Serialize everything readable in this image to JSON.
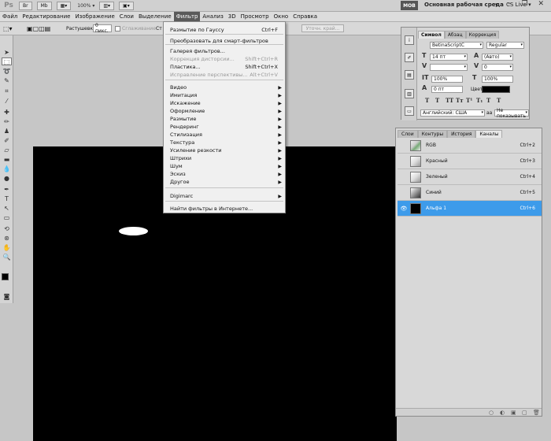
{
  "appbar": {
    "logo": "Ps",
    "zoom": "100%",
    "workspace_btn": "MOB",
    "workspace_title": "Основная рабочая среда",
    "workspace_arrow": "▾",
    "cslive": "CS Live ▾",
    "win_controls": "– ❐ ✕"
  },
  "menubar": [
    "Файл",
    "Редактирование",
    "Изображение",
    "Слои",
    "Выделение",
    "Фильтр",
    "Анализ",
    "3D",
    "Просмотр",
    "Окно",
    "Справка"
  ],
  "menubar_active": "Фильтр",
  "options": {
    "feather_label": "Растушевка:",
    "feather_value": "0 пикс.",
    "antialias": "Сглаживание",
    "style_label": "Ст",
    "refine_edge": "Уточн. край..."
  },
  "filter_menu": {
    "items": [
      {
        "label": "Размытие по Гауссу",
        "shortcut": "Ctrl+F"
      },
      {
        "label": "Преобразовать для смарт-фильтров"
      },
      {
        "label": "Галерея фильтров..."
      },
      {
        "label": "Коррекция дисторсии...",
        "shortcut": "Shift+Ctrl+R",
        "disabled": true
      },
      {
        "label": "Пластика...",
        "shortcut": "Shift+Ctrl+X"
      },
      {
        "label": "Исправление перспективы...",
        "shortcut": "Alt+Ctrl+V",
        "disabled": true
      },
      {
        "label": "Видео",
        "submenu": true
      },
      {
        "label": "Имитация",
        "submenu": true
      },
      {
        "label": "Искажение",
        "submenu": true
      },
      {
        "label": "Оформление",
        "submenu": true
      },
      {
        "label": "Размытие",
        "submenu": true
      },
      {
        "label": "Рендеринг",
        "submenu": true
      },
      {
        "label": "Стилизация",
        "submenu": true
      },
      {
        "label": "Текстура",
        "submenu": true
      },
      {
        "label": "Усиление резкости",
        "submenu": true
      },
      {
        "label": "Штрихи",
        "submenu": true
      },
      {
        "label": "Шум",
        "submenu": true
      },
      {
        "label": "Эскиз",
        "submenu": true
      },
      {
        "label": "Другое",
        "submenu": true
      },
      {
        "label": "Digimarc",
        "submenu": true
      },
      {
        "label": "Найти фильтры в Интернете..."
      }
    ]
  },
  "character_panel": {
    "tabs": [
      "Символ",
      "Абзац",
      "Коррекция"
    ],
    "font_family": "BetinaScriptC",
    "font_style": "Regular",
    "font_size": "14 пт",
    "leading": "(Авто)",
    "kerning": "",
    "tracking": "0",
    "vscale": "100%",
    "hscale": "100%",
    "baseline": "0 пт",
    "color_label": "Цвет:",
    "color_value": "#000000",
    "styles": [
      "T",
      "T",
      "TT",
      "Tт",
      "T¹",
      "T₁",
      "T",
      "T"
    ],
    "language": "Английский: США",
    "aa": "Не показывать"
  },
  "channels_panel": {
    "tabs": [
      "Слои",
      "Контуры",
      "История",
      "Каналы"
    ],
    "active_tab": "Каналы",
    "rows": [
      {
        "name": "RGB",
        "shortcut": "Ctrl+2"
      },
      {
        "name": "Красный",
        "shortcut": "Ctrl+3"
      },
      {
        "name": "Зеленый",
        "shortcut": "Ctrl+4"
      },
      {
        "name": "Синий",
        "shortcut": "Ctrl+5"
      },
      {
        "name": "Альфа 1",
        "shortcut": "Ctrl+6",
        "selected": true
      }
    ],
    "footer_icons": [
      "○",
      "◐",
      "▣",
      "▢",
      "🗑"
    ]
  },
  "colors": {
    "selection": "#3d9bea",
    "menu_active": "#5a5a5a",
    "canvas": "#000000"
  }
}
